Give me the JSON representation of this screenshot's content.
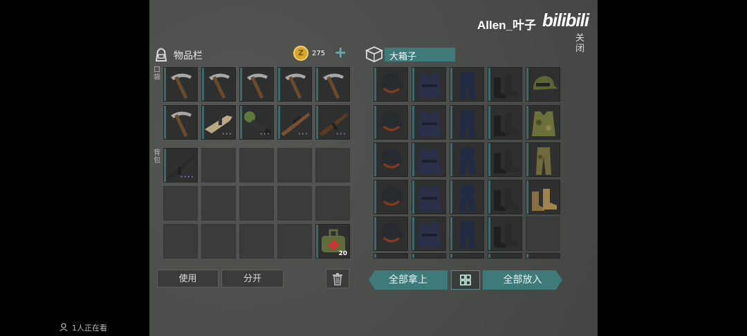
{
  "watermark": {
    "user": "Allen_叶子",
    "logo": "bilibili",
    "close_label": "关闭"
  },
  "inventory": {
    "title": "物品栏",
    "coins": "275",
    "pocket_label": "口袋",
    "backpack_label": "背包",
    "pocket_items": [
      "pickaxe-icon",
      "pickaxe-icon",
      "pickaxe-icon",
      "pickaxe-icon",
      "pickaxe-icon",
      "pickaxe-icon",
      "scar-rifle-icon",
      "flamethrower-icon",
      "sniper-rifle-icon",
      "ak-rifle-icon"
    ],
    "backpack_first_item": "m16-rifle-icon",
    "medkit_qty": "20"
  },
  "chest": {
    "title": "大箱子",
    "rows": [
      [
        "helmet-icon",
        "vest-icon",
        "pants-icon",
        "boots-icon",
        "cap-icon"
      ],
      [
        "helmet-icon",
        "vest-icon",
        "pants-icon",
        "boots-icon",
        "camo-vest-icon"
      ],
      [
        "helmet-icon",
        "vest-icon",
        "pants-icon",
        "boots-icon",
        "camo-pants-icon"
      ],
      [
        "helmet-icon",
        "vest-icon",
        "pants-icon",
        "boots-icon",
        "desert-boots-icon"
      ],
      [
        "helmet-icon",
        "vest-icon",
        "pants-icon",
        "boots-icon",
        ""
      ]
    ]
  },
  "buttons": {
    "use": "使用",
    "split": "分开",
    "take_all": "全部拿上",
    "put_all": "全部放入"
  },
  "viewers": "1人正在看",
  "colors": {
    "accent": "#3e7a7a",
    "slot": "#2d302f",
    "coin": "#d8a62a"
  }
}
